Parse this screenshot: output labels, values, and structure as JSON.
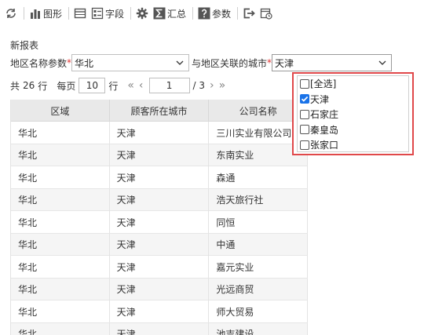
{
  "toolbar": {
    "items": [
      {
        "icon": "refresh-icon",
        "label": ""
      },
      {
        "icon": "chart-icon",
        "label": "图形"
      },
      {
        "icon": "table-icon",
        "label": ""
      },
      {
        "icon": "field-icon",
        "label": "字段"
      },
      {
        "icon": "gear-icon",
        "label": ""
      },
      {
        "icon": "sum-icon",
        "label": "汇总"
      },
      {
        "icon": "help-icon",
        "label": "参数"
      },
      {
        "icon": "export-icon",
        "label": ""
      },
      {
        "icon": "calendar-icon",
        "label": ""
      }
    ]
  },
  "report": {
    "title": "新报表"
  },
  "params": {
    "region_label": "地区名称参数",
    "required_mark": "*",
    "region_value": "华北",
    "city_label": "与地区关联的城市",
    "city_value": "天津"
  },
  "pager": {
    "total_prefix": "共",
    "total": "26",
    "total_suffix": "行",
    "per_page_prefix": "每页",
    "per_page": "10",
    "per_page_suffix": "行",
    "first": "«",
    "prev": "‹",
    "page": "1",
    "of": "/ 3",
    "next": "›",
    "last": "»"
  },
  "table": {
    "columns": [
      "区域",
      "顾客所在城市",
      "公司名称"
    ],
    "rows": [
      [
        "华北",
        "天津",
        "三川实业有限公司"
      ],
      [
        "华北",
        "天津",
        "东南实业"
      ],
      [
        "华北",
        "天津",
        "森通"
      ],
      [
        "华北",
        "天津",
        "浩天旅行社"
      ],
      [
        "华北",
        "天津",
        "同恒"
      ],
      [
        "华北",
        "天津",
        "中通"
      ],
      [
        "华北",
        "天津",
        "嘉元实业"
      ],
      [
        "华北",
        "天津",
        "光远商贸"
      ],
      [
        "华北",
        "天津",
        "师大贸易"
      ],
      [
        "华北",
        "天津",
        "池吉建设"
      ]
    ]
  },
  "dropdown": {
    "options": [
      {
        "label": "[全选]",
        "checked": false
      },
      {
        "label": "天津",
        "checked": true
      },
      {
        "label": "石家庄",
        "checked": false
      },
      {
        "label": "秦皇岛",
        "checked": false
      },
      {
        "label": "张家口",
        "checked": false
      }
    ]
  },
  "colors": {
    "accent": "#1a73e8",
    "highlight_border": "#e0484a",
    "required": "#e0312f"
  }
}
